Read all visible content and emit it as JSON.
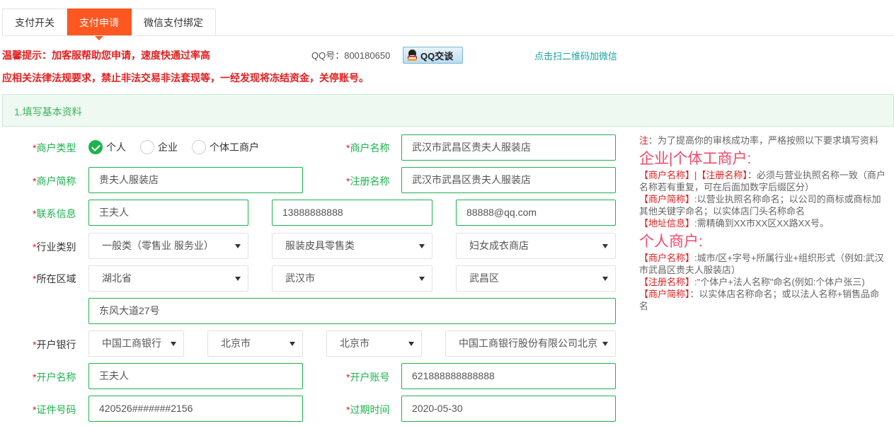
{
  "tabs": [
    {
      "label": "支付开关",
      "active": false
    },
    {
      "label": "支付申请",
      "active": true
    },
    {
      "label": "微信支付绑定",
      "active": false
    }
  ],
  "notice": {
    "line1": "温馨提示：加客服帮助您申请，速度快通过率高",
    "line2": "应相关法律法规要求，禁止非法交易非法套现等，一经发现将冻结资金，关停账号。",
    "qq_label": "QQ号：800180650",
    "qq_button": "QQ交谈",
    "scan_link": "点击扫二维码加微信"
  },
  "section": {
    "title": "1.填写基本资料"
  },
  "form": {
    "merchant_type": {
      "label": "商户类型",
      "options": [
        "个人",
        "企业",
        "个体工商户"
      ],
      "selected": "个人"
    },
    "merchant_name": {
      "label": "商户名称",
      "value": "武汉市武昌区贵夫人服装店"
    },
    "short_name": {
      "label": "商户简称",
      "value": "贵夫人服装店"
    },
    "register_name": {
      "label": "注册名称",
      "value": "武汉市武昌区贵夫人服装店"
    },
    "contact": {
      "label": "联系信息",
      "name": "王夫人",
      "phone": "13888888888",
      "email": "88888@qq.com"
    },
    "industry": {
      "label": "行业类别",
      "level1": "一般类（零售业 服务业）",
      "level2": "服装皮具零售类",
      "level3": "妇女成衣商店"
    },
    "region": {
      "label": "所在区域",
      "province": "湖北省",
      "city": "武汉市",
      "district": "武昌区",
      "address": "东风大道27号"
    },
    "bank": {
      "label": "开户银行",
      "bank": "中国工商银行",
      "province": "北京市",
      "city": "北京市",
      "branch": "中国工商银行股份有限公司北京"
    },
    "account_name": {
      "label": "开户名称",
      "value": "王夫人"
    },
    "account_no": {
      "label": "开户账号",
      "value": "621888888888888"
    },
    "id_no": {
      "label": "证件号码",
      "value": "420526#######2156"
    },
    "expire": {
      "label": "过期时间",
      "value": "2020-05-30"
    }
  },
  "notes": {
    "intro_title": "注",
    "intro": "：为了提高你的审核成功率，严格按照以下要求填写资料",
    "company_heading": "企业|个体工商户:",
    "c1_tag": "【商户名称】|【注册名称】",
    "c1_text": "：必须与营业执照名称一致（商户名称若有重复，可在后面加数字后缀区分）",
    "c2_tag": "【商户简称】",
    "c2_text": ":以营业执照名称命名；以公司的商标或商标加其他关键字命名；以实体店门头名称命名",
    "c3_tag": "【地址信息】",
    "c3_text": ":需精确到XX市XX区XX路XX号。",
    "personal_heading": "个人商户:",
    "p1_tag": "【商户名称】",
    "p1_text": ":城市/区+字号+所属行业+组织形式（例如:武汉市武昌区贵夫人服装店）",
    "p2_tag": "【注册名称】",
    "p2_text": ":\"个体户+法人名称\"命名(例如:个体户张三)",
    "p3_tag": "【商户简称】",
    "p3_text": "：以实体店名称命名；或以法人名称+销售品命名"
  },
  "colors": {
    "accent": "#ff5722",
    "green": "#1db34d",
    "red": "#e02020",
    "pink": "#ef4a6b"
  }
}
